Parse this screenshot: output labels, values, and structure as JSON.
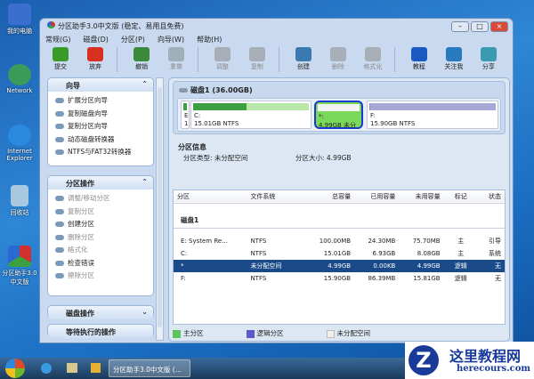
{
  "desktop": {
    "icons": [
      "我的电脑",
      "Network",
      "Internet Explorer",
      "回收站",
      "分区助手3.0中文版"
    ]
  },
  "window": {
    "title": "分区助手3.0中文版 (稳定、易用且免费)",
    "controls": [
      "minimize",
      "maximize",
      "close"
    ]
  },
  "menu": [
    "常规(G)",
    "磁盘(D)",
    "分区(P)",
    "向导(W)",
    "帮助(H)"
  ],
  "toolbar": [
    {
      "label": "提交",
      "icon": "check-icon",
      "color": "#3a9a2a",
      "enabled": true
    },
    {
      "label": "放弃",
      "icon": "x-icon",
      "color": "#d83020",
      "enabled": true
    },
    {
      "label": "撤销",
      "icon": "undo-icon",
      "color": "#3a8a3a",
      "enabled": true
    },
    {
      "label": "重做",
      "icon": "redo-icon",
      "color": "#7a9090",
      "enabled": false
    },
    {
      "label": "调整",
      "icon": "resize-icon",
      "color": "#8a8a8a",
      "enabled": false
    },
    {
      "label": "复制",
      "icon": "copy-icon",
      "color": "#8a8a8a",
      "enabled": false
    },
    {
      "label": "创建",
      "icon": "create-icon",
      "color": "#3a7ab0",
      "enabled": true
    },
    {
      "label": "删除",
      "icon": "delete-icon",
      "color": "#8a8a8a",
      "enabled": false
    },
    {
      "label": "格式化",
      "icon": "format-icon",
      "color": "#8a8a8a",
      "enabled": false
    },
    {
      "label": "教程",
      "icon": "help-icon",
      "color": "#1a5ac0",
      "enabled": true
    },
    {
      "label": "关注我",
      "icon": "follow-icon",
      "color": "#2a7ac0",
      "enabled": true
    },
    {
      "label": "分享",
      "icon": "share-icon",
      "color": "#3a9ab0",
      "enabled": true
    }
  ],
  "sidebar": {
    "wizard": {
      "title": "向导",
      "items": [
        "扩展分区向导",
        "复制磁盘向导",
        "复制分区向导",
        "动态磁盘转换器",
        "NTFS与FAT32转换器"
      ]
    },
    "partition_ops": {
      "title": "分区操作",
      "items": [
        {
          "label": "调整/移动分区",
          "enabled": false
        },
        {
          "label": "复制分区",
          "enabled": false
        },
        {
          "label": "创建分区",
          "enabled": true
        },
        {
          "label": "删除分区",
          "enabled": false
        },
        {
          "label": "格式化",
          "enabled": false
        },
        {
          "label": "检查错误",
          "enabled": true
        },
        {
          "label": "擦除分区",
          "enabled": false
        }
      ]
    },
    "disk_ops": {
      "title": "磁盘操作"
    },
    "pending": {
      "title": "等待执行的操作"
    }
  },
  "diskmap": {
    "title": "磁盘1 (36.00GB)",
    "parts": [
      {
        "name": "E",
        "line2": "1",
        "fill": 1.0
      },
      {
        "name": "C:",
        "line2": "15.01GB NTFS",
        "fill": 0.46
      },
      {
        "name": "*:",
        "line2": "4.99GB 未分",
        "fill": 0
      },
      {
        "name": "F:",
        "line2": "15.90GB NTFS",
        "fill": 0.01
      }
    ]
  },
  "info": {
    "title": "分区信息",
    "type_label": "分区类型: 未分配空间",
    "size_label": "分区大小: 4.99GB"
  },
  "table": {
    "headers": [
      "分区",
      "文件系统",
      "总容量",
      "已用容量",
      "未用容量",
      "标记",
      "状态"
    ],
    "disk": "磁盘1",
    "rows": [
      [
        "E:  System Re...",
        "NTFS",
        "100.00MB",
        "24.30MB",
        "75.70MB",
        "主",
        "引导"
      ],
      [
        "C:",
        "NTFS",
        "15.01GB",
        "6.93GB",
        "8.08GB",
        "主",
        "系统"
      ],
      [
        "*",
        "未分配空间",
        "4.99GB",
        "0.00KB",
        "4.99GB",
        "逻辑",
        "无"
      ],
      [
        "F:",
        "NTFS",
        "15.90GB",
        "86.39MB",
        "15.81GB",
        "逻辑",
        "无"
      ]
    ]
  },
  "legend": [
    "主分区",
    "逻辑分区",
    "未分配空间"
  ],
  "taskbar": {
    "task": "分区助手3.0中文版 (..."
  },
  "watermark": {
    "name": "这里教程网",
    "url": "herecours.com"
  }
}
